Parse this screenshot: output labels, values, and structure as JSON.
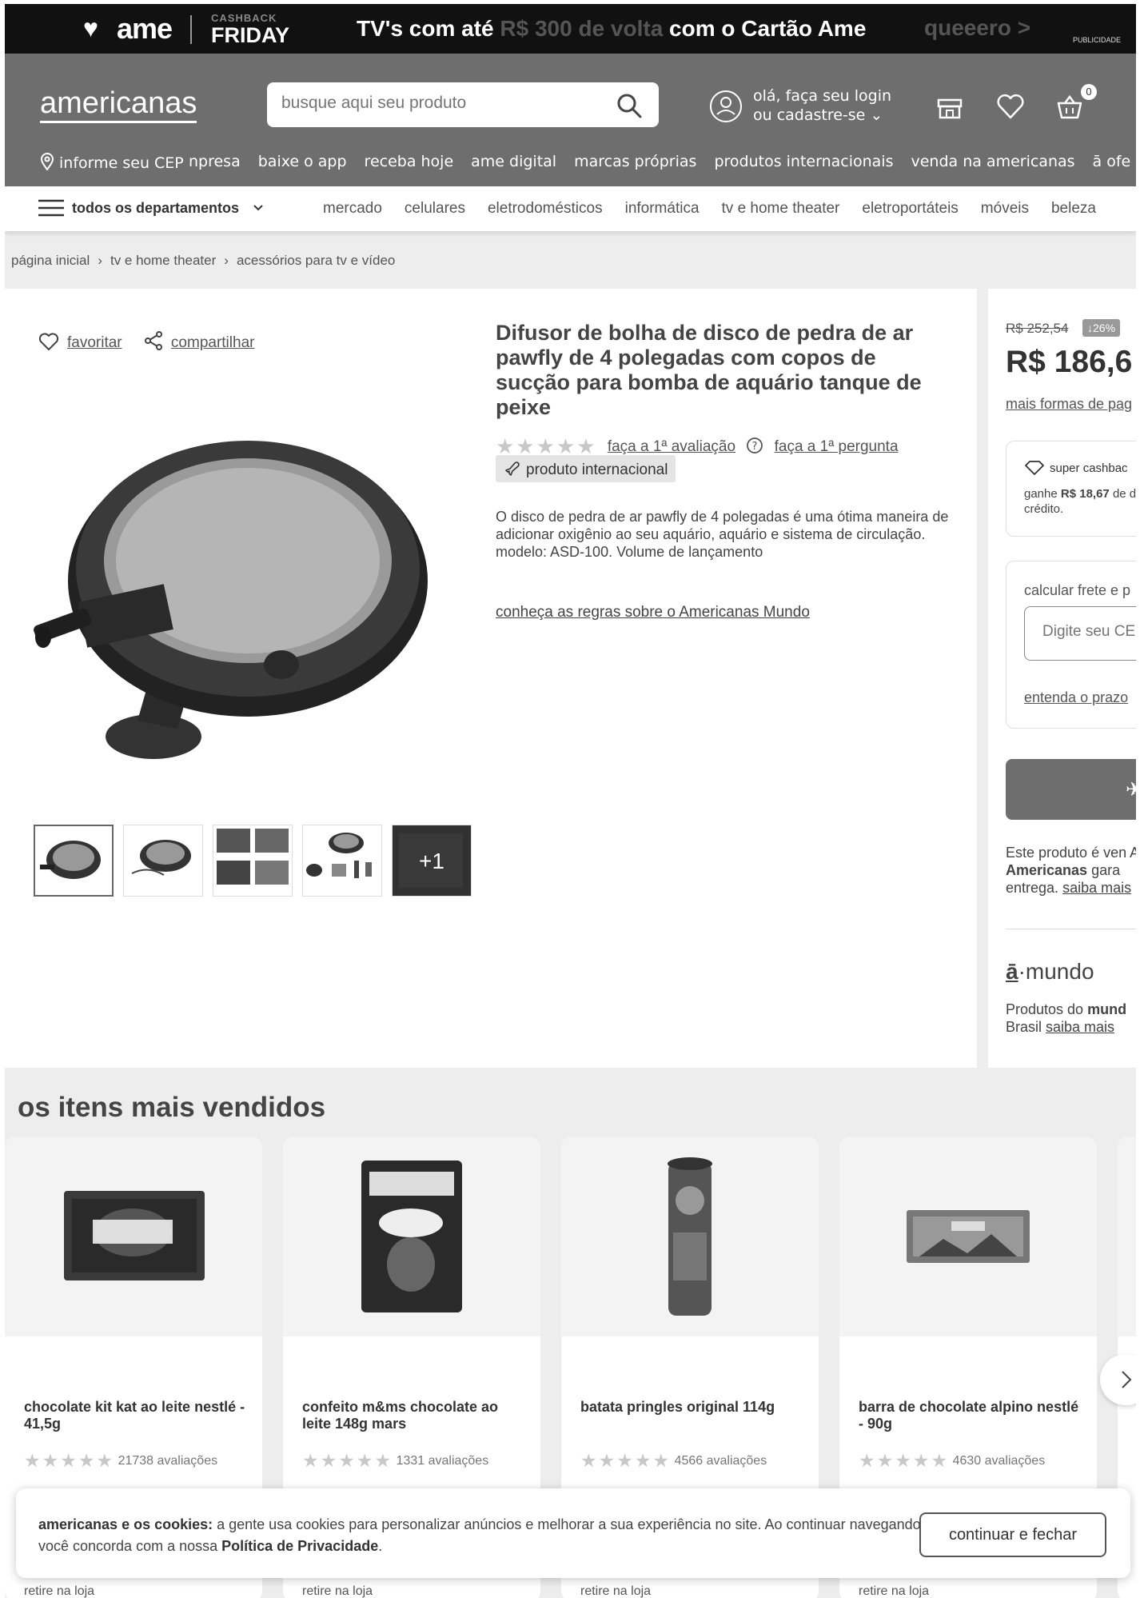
{
  "promo": {
    "brand": "ame",
    "cashback_top": "CASHBACK",
    "cashback_bottom": "FRIDAY",
    "headline_a": "TV's com até ",
    "headline_b": "R$ 300 de volta",
    "headline_c": " com o Cartão Ame",
    "cta": "queeero >",
    "label": "PUBLICIDADE"
  },
  "header": {
    "logo": "americanas",
    "search_placeholder": "busque aqui seu produto",
    "login_line1": "olá, faça seu login",
    "login_line2": "ou cadastre-se ⌄",
    "cart_count": "0",
    "cep": "informe seu CEP",
    "links": [
      "npresa",
      "baixe o app",
      "receba hoje",
      "ame digital",
      "marcas próprias",
      "produtos internacionais",
      "venda na americanas",
      "ā ofe"
    ]
  },
  "departments": {
    "menu_label": "todos os departamentos",
    "items": [
      "mercado",
      "celulares",
      "eletrodomésticos",
      "informática",
      "tv e home theater",
      "eletroportáteis",
      "móveis",
      "beleza"
    ]
  },
  "breadcrumb": [
    "página inicial",
    "tv e home theater",
    "acessórios para tv e vídeo"
  ],
  "product": {
    "favorite": "favoritar",
    "share": "compartilhar",
    "title": "Difusor de bolha de disco de pedra de ar pawfly de 4 polegadas com copos de sucção para bomba de aquário tanque de peixe",
    "stars": "★★★★★",
    "first_review": "faça a 1ª avaliação",
    "first_question": "faça a 1ª pergunta",
    "international": "produto internacional",
    "description": "O disco de pedra de ar pawfly de 4 polegadas é uma ótima maneira de adicionar oxigênio ao seu aquário, aquário e sistema de circulação. modelo: ASD-100. Volume de lançamento",
    "rules_link": "conheça as regras sobre o Americanas Mundo",
    "more_images": "+1"
  },
  "buybox": {
    "old_price": "R$ 252,54",
    "discount": "↓26%",
    "price": "R$ 186,6",
    "payment_link": "mais formas de pag",
    "cashback_title": "super cashbac",
    "cashback_text_a": "ganhe ",
    "cashback_amount": "R$ 18,67",
    "cashback_text_b": " de de crédito.",
    "shipping_title": "calcular frete e p",
    "cep_placeholder": "Digite seu CE",
    "deadline_link": "entenda o prazo",
    "seller_text_a": "Este produto é ven A ",
    "seller_brand": "Americanas",
    "seller_text_b": " gara entrega. ",
    "seller_link": "saiba mais",
    "mundo_a": "ā",
    "mundo_b": "·mundo",
    "mundo_text_a": "Produtos do ",
    "mundo_text_bold": "mund",
    "mundo_text_b": " Brasil ",
    "mundo_link": "saiba mais"
  },
  "bestsellers": {
    "title": "os itens mais vendidos",
    "items": [
      {
        "name": "chocolate kit kat ao leite nestlé - 41,5g",
        "stars": "★★★★★",
        "reviews": "21738 avaliações",
        "pickup": "retire na loja"
      },
      {
        "name": "confeito m&ms chocolate ao leite 148g mars",
        "stars": "★★★★★",
        "reviews": "1331 avaliações",
        "pickup": "retire na loja"
      },
      {
        "name": "batata pringles original 114g",
        "stars": "★★★★★",
        "reviews": "4566 avaliações",
        "pickup": "retire na loja"
      },
      {
        "name": "barra de chocolate alpino nestlé - 90g",
        "stars": "★★★★★",
        "reviews": "4630 avaliações",
        "pickup": "retire na loja"
      }
    ]
  },
  "cookie": {
    "bold": "americanas e os cookies:",
    "text": " a gente usa cookies para personalizar anúncios e melhorar a sua experiência no site. Ao continuar navegando, você concorda com a nossa ",
    "policy": "Política de Privacidade",
    "end": ".",
    "button": "continuar e fechar"
  },
  "colors": {
    "header": "#6e6e6e",
    "promo": "#111111",
    "panel_bg": "#ededed"
  }
}
